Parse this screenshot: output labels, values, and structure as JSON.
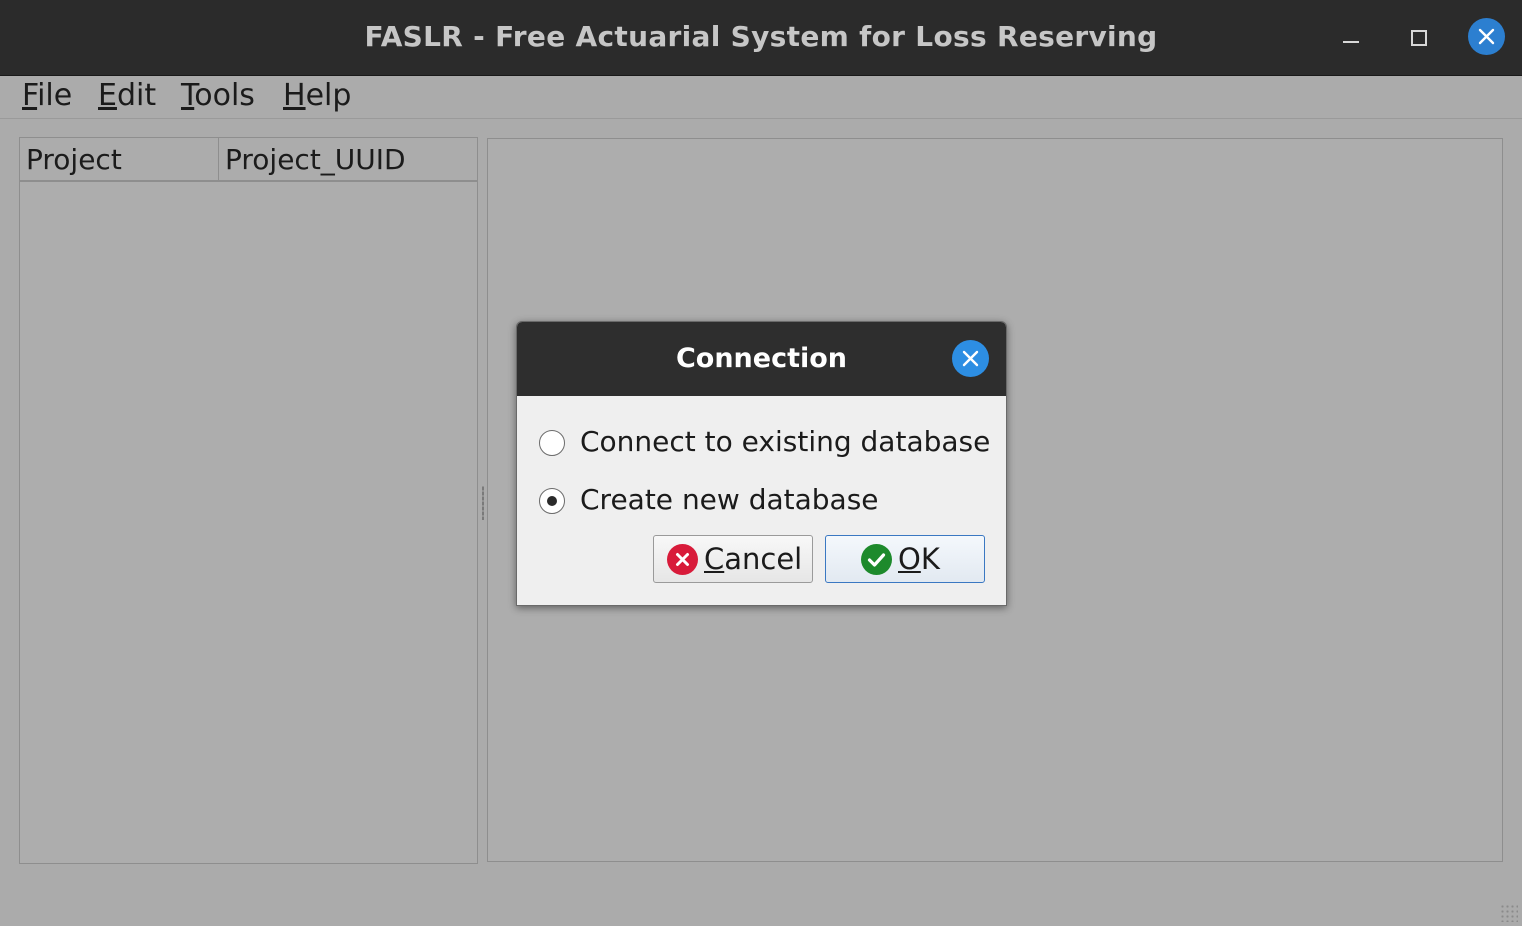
{
  "window": {
    "title": "FASLR - Free Actuarial System for Loss Reserving"
  },
  "menubar": {
    "items": [
      {
        "mnemonic": "F",
        "rest": "ile"
      },
      {
        "mnemonic": "E",
        "rest": "dit"
      },
      {
        "mnemonic": "T",
        "rest": "ools"
      },
      {
        "mnemonic": "H",
        "rest": "elp"
      }
    ]
  },
  "project_table": {
    "columns": [
      "Project",
      "Project_UUID"
    ],
    "rows": []
  },
  "dialog": {
    "title": "Connection",
    "options": [
      {
        "label": "Connect to existing database",
        "checked": false
      },
      {
        "label": "Create new database",
        "checked": true
      }
    ],
    "cancel": {
      "mnemonic": "C",
      "rest": "ancel"
    },
    "ok": {
      "mnemonic": "O",
      "rest": "K"
    }
  },
  "icons": {
    "window_close": "close-icon",
    "cancel": "x-circle-icon",
    "ok": "check-circle-icon"
  },
  "colors": {
    "titlebar": "#2b2b2b",
    "accent_close": "#2c7fd0",
    "cancel_icon": "#d81b3a",
    "ok_icon": "#1d8a2c"
  }
}
